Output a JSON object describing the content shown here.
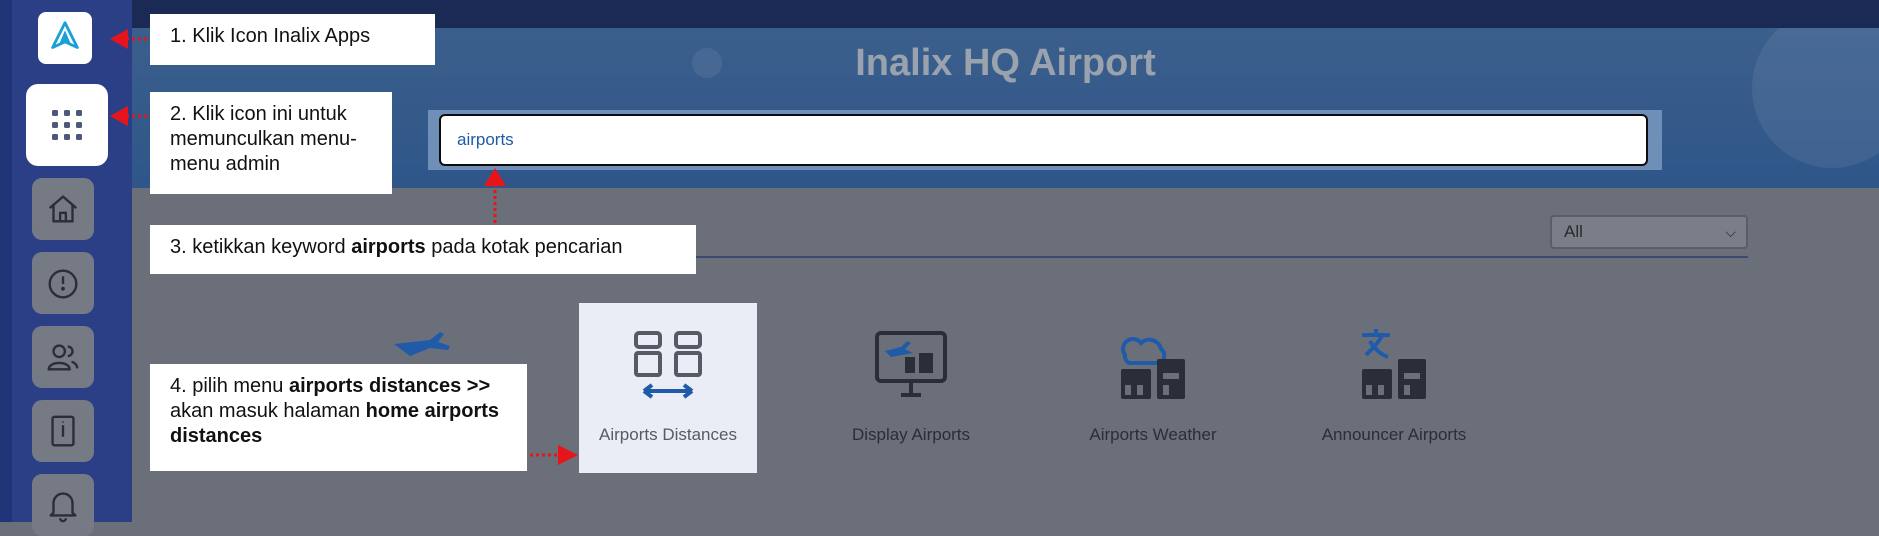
{
  "header": {
    "title": "Inalix HQ Airport"
  },
  "search": {
    "value": "airports"
  },
  "filter": {
    "selected": "All"
  },
  "apps": [
    {
      "label": "Airports Distances",
      "icon": "airports-distances-icon"
    },
    {
      "label": "Display Airports",
      "icon": "display-airports-icon"
    },
    {
      "label": "Airports Weather",
      "icon": "airports-weather-icon"
    },
    {
      "label": "Announcer Airports",
      "icon": "announcer-airports-icon"
    }
  ],
  "notes": {
    "step1": "1. Klik Icon Inalix Apps",
    "step2": "2. Klik icon ini untuk memunculkan menu-menu admin",
    "step3_pre": "3. ketikkan keyword ",
    "step3_bold": "airports",
    "step3_post": " pada kotak pencarian",
    "step4_pre": "4. pilih menu ",
    "step4_bold1": "airports distances >>",
    "step4_mid": " akan masuk halaman ",
    "step4_bold2": "home airports distances"
  },
  "colors": {
    "accent": "#1f5ba8",
    "annotation_arrow": "#e8141b",
    "rail": "#1f3577"
  }
}
